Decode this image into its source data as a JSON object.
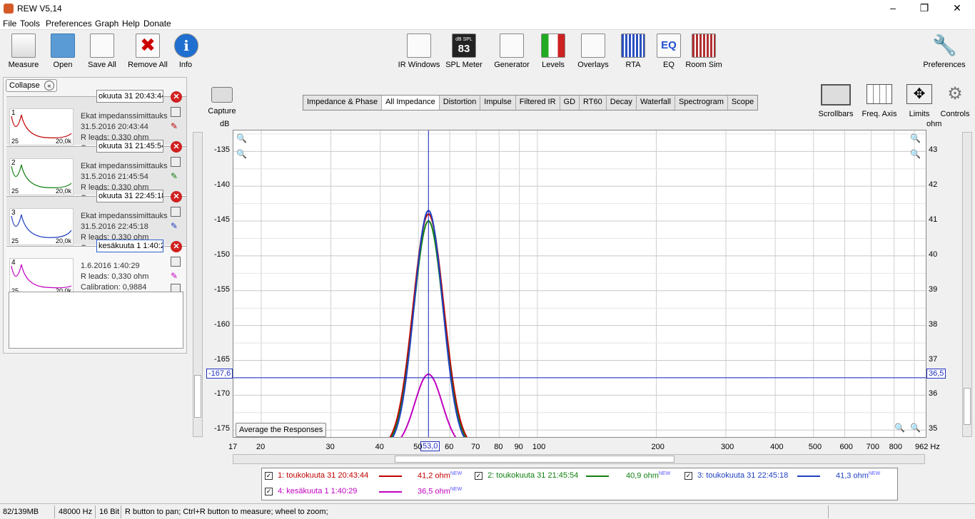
{
  "window": {
    "title": "REW V5,14"
  },
  "menu": [
    "File",
    "Tools",
    "Preferences",
    "Graph",
    "Help",
    "Donate"
  ],
  "toolbar": {
    "left": [
      "Measure",
      "Open",
      "Save All",
      "Remove All",
      "Info"
    ],
    "center": [
      "IR Windows",
      "SPL Meter",
      "Generator",
      "Levels",
      "Overlays",
      "RTA",
      "EQ",
      "Room Sim"
    ],
    "spl_icon": {
      "top": "dB SPL",
      "value": "83"
    },
    "right": "Preferences"
  },
  "left_panel": {
    "collapse_label": "Collapse",
    "measurements": [
      {
        "num": "1",
        "name": "okuuta 31 20:43:44",
        "line1": "Ekat impedanssimittauks",
        "line2": "31.5.2016 20:43:44",
        "line3": "R leads: 0,330 ohm",
        "line4": "Ca",
        "x0": "25",
        "x1": "20,0k",
        "color": "#c00000"
      },
      {
        "num": "2",
        "name": "okuuta 31 21:45:54",
        "line1": "Ekat impedanssimittauks",
        "line2": "31.5.2016 21:45:54",
        "line3": "R leads: 0,330 ohm",
        "line4": "Ca",
        "x0": "25",
        "x1": "20,0k",
        "color": "#108010"
      },
      {
        "num": "3",
        "name": "okuuta 31 22:45:18",
        "line1": "Ekat impedanssimittauks",
        "line2": "31.5.2016 22:45:18",
        "line3": "R leads: 0,330 ohm",
        "line4": "Ca",
        "x0": "25",
        "x1": "20,0k",
        "color": "#2040c0"
      },
      {
        "num": "4",
        "name": "kesäkuuta 1 1:40:29",
        "line1": "1.6.2016 1:40:29",
        "line2": "R leads: 0,330 ohm",
        "line3": "Calibration: 0,9884",
        "line4": "",
        "x0": "25",
        "x1": "20,0k",
        "color": "#c000c0"
      }
    ]
  },
  "capture_label": "Capture",
  "tabs": [
    "Impedance & Phase",
    "All Impedance",
    "Distortion",
    "Impulse",
    "Filtered IR",
    "GD",
    "RT60",
    "Decay",
    "Waterfall",
    "Spectrogram",
    "Scope"
  ],
  "active_tab": "All Impedance",
  "right_tools": [
    "Scrollbars",
    "Freq. Axis",
    "Limits",
    "Controls"
  ],
  "chart_data": {
    "type": "line",
    "ylabel_left": "dB",
    "ylabel_right": "ohm",
    "y_left_ticks": [
      "-135",
      "-140",
      "-145",
      "-150",
      "-155",
      "-160",
      "-165",
      "-170",
      "-175"
    ],
    "y_right_ticks": [
      "43",
      "42",
      "41",
      "40",
      "39",
      "38",
      "37",
      "36",
      "35"
    ],
    "x_ticks": [
      "17",
      "20",
      "30",
      "40",
      "50",
      "60",
      "70",
      "80",
      "90",
      "100",
      "200",
      "300",
      "400",
      "500",
      "600",
      "700",
      "800",
      "962 Hz"
    ],
    "x_scale": "log",
    "xlim": [
      17,
      962
    ],
    "ylim_right": [
      34.8,
      43.6
    ],
    "cursor": {
      "x_label": "53,0",
      "y_left": "-167,6",
      "y_right": "36,5"
    },
    "series": [
      {
        "name": "1: toukokuuta 31 20:43:44",
        "value": "41,2 ohm",
        "color": "#c00000",
        "peak": 41.2
      },
      {
        "name": "2: toukokuuta 31 21:45:54",
        "value": "40,9 ohm",
        "color": "#108010",
        "peak": 41.0
      },
      {
        "name": "3: toukokuuta 31 22:45:18",
        "value": "41,3 ohm",
        "color": "#2040c0",
        "peak": 41.3
      },
      {
        "name": "4: kesäkuuta 1 1:40:29",
        "value": "36,5 ohm",
        "color": "#c000c0",
        "peak": 36.6
      }
    ],
    "peak_freq": 53,
    "new_tag": "NEW"
  },
  "avg_button": "Average the Responses",
  "status": {
    "memory": "82/139MB",
    "rate": "48000 Hz",
    "bits": "16 Bit",
    "hint": "R button to pan; Ctrl+R button to measure; wheel to zoom;"
  }
}
